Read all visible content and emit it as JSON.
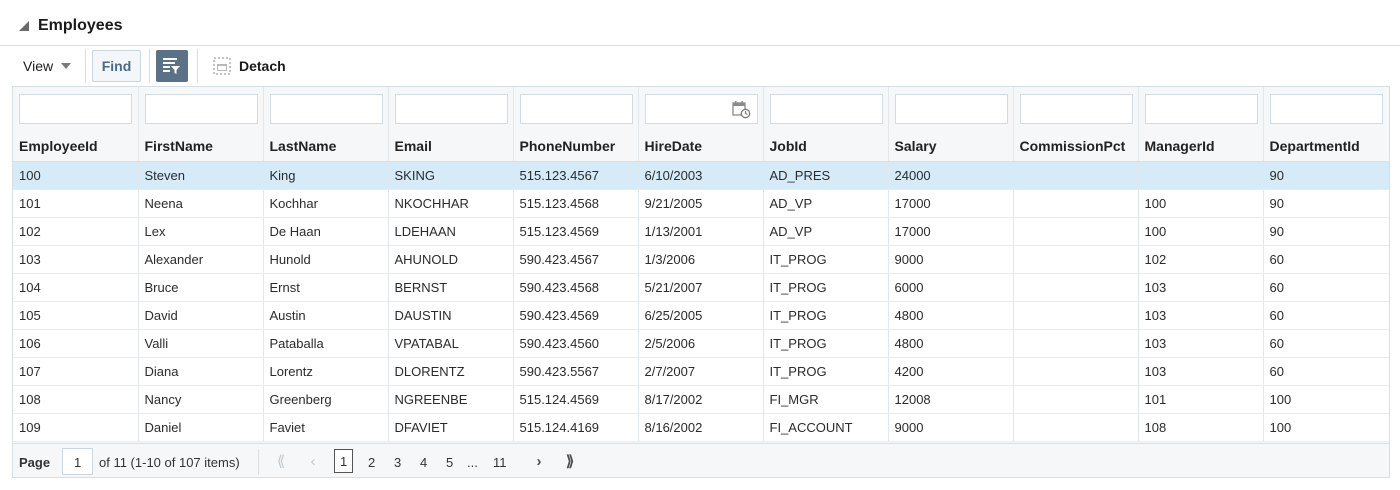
{
  "panel": {
    "title": "Employees"
  },
  "toolbar": {
    "view_label": "View",
    "find_label": "Find",
    "detach_label": "Detach"
  },
  "table": {
    "columns": [
      "EmployeeId",
      "FirstName",
      "LastName",
      "Email",
      "PhoneNumber",
      "HireDate",
      "JobId",
      "Salary",
      "CommissionPct",
      "ManagerId",
      "DepartmentId"
    ],
    "rows": [
      [
        "100",
        "Steven",
        "King",
        "SKING",
        "515.123.4567",
        "6/10/2003",
        "AD_PRES",
        "24000",
        "",
        "",
        "90"
      ],
      [
        "101",
        "Neena",
        "Kochhar",
        "NKOCHHAR",
        "515.123.4568",
        "9/21/2005",
        "AD_VP",
        "17000",
        "",
        "100",
        "90"
      ],
      [
        "102",
        "Lex",
        "De Haan",
        "LDEHAAN",
        "515.123.4569",
        "1/13/2001",
        "AD_VP",
        "17000",
        "",
        "100",
        "90"
      ],
      [
        "103",
        "Alexander",
        "Hunold",
        "AHUNOLD",
        "590.423.4567",
        "1/3/2006",
        "IT_PROG",
        "9000",
        "",
        "102",
        "60"
      ],
      [
        "104",
        "Bruce",
        "Ernst",
        "BERNST",
        "590.423.4568",
        "5/21/2007",
        "IT_PROG",
        "6000",
        "",
        "103",
        "60"
      ],
      [
        "105",
        "David",
        "Austin",
        "DAUSTIN",
        "590.423.4569",
        "6/25/2005",
        "IT_PROG",
        "4800",
        "",
        "103",
        "60"
      ],
      [
        "106",
        "Valli",
        "Pataballa",
        "VPATABAL",
        "590.423.4560",
        "2/5/2006",
        "IT_PROG",
        "4800",
        "",
        "103",
        "60"
      ],
      [
        "107",
        "Diana",
        "Lorentz",
        "DLORENTZ",
        "590.423.5567",
        "2/7/2007",
        "IT_PROG",
        "4200",
        "",
        "103",
        "60"
      ],
      [
        "108",
        "Nancy",
        "Greenberg",
        "NGREENBE",
        "515.124.4569",
        "8/17/2002",
        "FI_MGR",
        "12008",
        "",
        "101",
        "100"
      ],
      [
        "109",
        "Daniel",
        "Faviet",
        "DFAVIET",
        "515.124.4169",
        "8/16/2002",
        "FI_ACCOUNT",
        "9000",
        "",
        "108",
        "100"
      ]
    ],
    "selected_row": 0
  },
  "pager": {
    "page_label": "Page",
    "page_value": "1",
    "of_text": "of 11  (1-10 of 107 items)",
    "pages": [
      "1",
      "2",
      "3",
      "4",
      "5"
    ],
    "ellipsis": "...",
    "last_page": "11",
    "first_icon": "⟪",
    "prev_icon": "‹",
    "next_icon": "›",
    "last_icon": "⟫"
  },
  "colors": {
    "selected_row": "#d6ebf8",
    "header_bg": "#f5f7f9",
    "filter_button": "#5b7188",
    "find_text": "#4a6a8a"
  }
}
